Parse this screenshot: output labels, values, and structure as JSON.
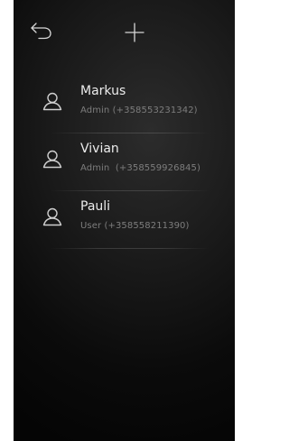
{
  "header": {
    "back_icon": "undo-arrow-icon",
    "add_icon": "plus-icon"
  },
  "contacts": [
    {
      "name": "Markus",
      "detail": "Admin (+358553231342)",
      "icon": "user-icon"
    },
    {
      "name": "Vivian",
      "detail": "Admin  (+358559926845)",
      "icon": "user-icon"
    },
    {
      "name": "Pauli",
      "detail": "User (+358558211390)",
      "icon": "user-icon"
    }
  ],
  "colors": {
    "background": "#000000",
    "text_primary": "#ececec",
    "text_secondary": "#7d7d7d"
  }
}
